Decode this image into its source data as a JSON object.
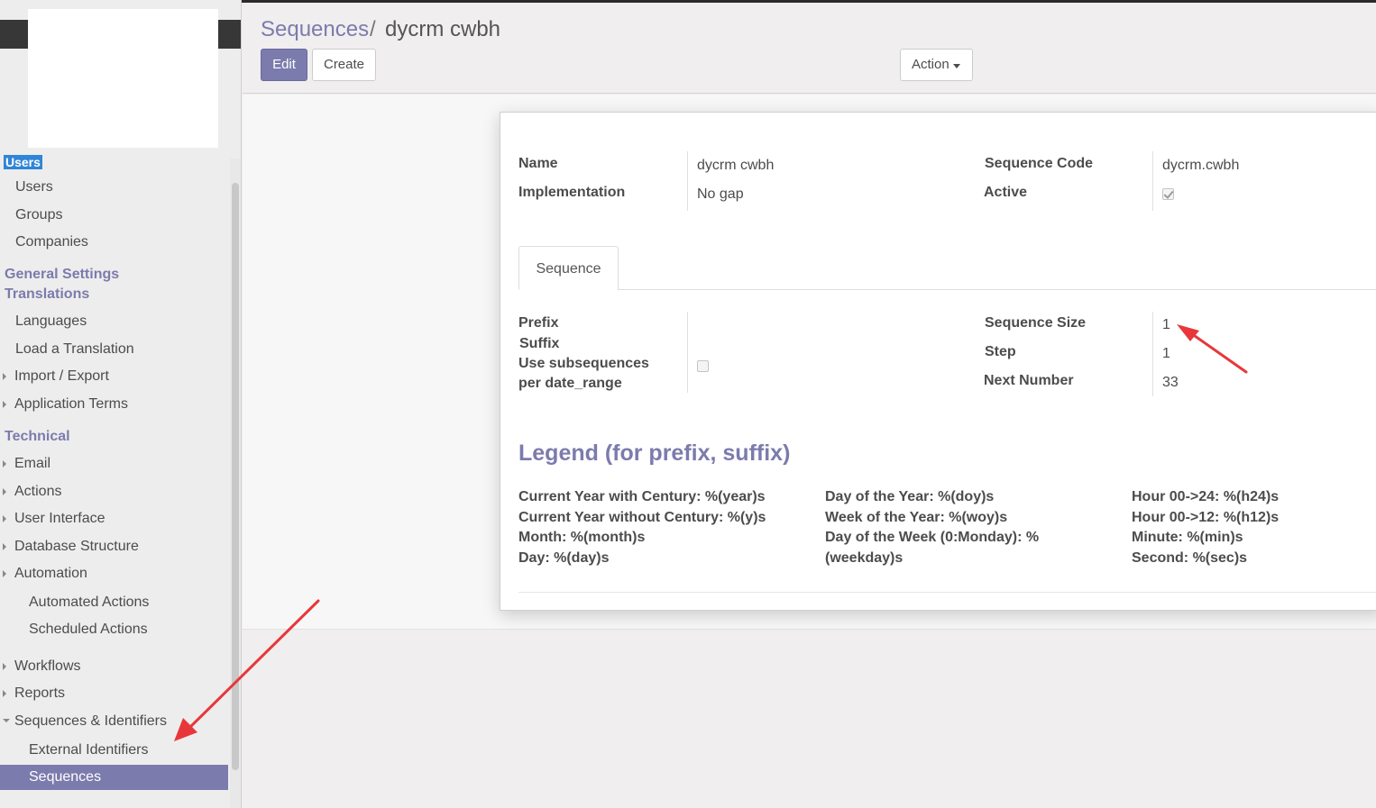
{
  "sidebar": {
    "section_users": "Users",
    "users_items": [
      "Users",
      "Groups",
      "Companies"
    ],
    "section_general": "General Settings",
    "section_translations": "Translations",
    "translation_items": [
      "Languages",
      "Load a Translation"
    ],
    "import_export": "Import / Export",
    "application_terms": "Application Terms",
    "section_technical": "Technical",
    "technical_items": [
      "Email",
      "Actions",
      "User Interface",
      "Database Structure",
      "Automation"
    ],
    "automation_children": [
      "Automated Actions",
      "Scheduled Actions"
    ],
    "workflows": "Workflows",
    "reports": "Reports",
    "sequences_identifiers": "Sequences & Identifiers",
    "seq_children": [
      "External Identifiers",
      "Sequences"
    ]
  },
  "control_panel": {
    "breadcrumb_parent": "Sequences",
    "breadcrumb_separator": "/",
    "breadcrumb_current": "dycrm cwbh",
    "edit_label": "Edit",
    "create_label": "Create",
    "action_label": "Action"
  },
  "form": {
    "name_label": "Name",
    "name_value": "dycrm cwbh",
    "implementation_label": "Implementation",
    "implementation_value": "No gap",
    "sequence_code_label": "Sequence Code",
    "sequence_code_value": "dycrm.cwbh",
    "active_label": "Active",
    "active_checked": true,
    "tab_label": "Sequence",
    "prefix_label": "Prefix",
    "suffix_label": "Suffix",
    "use_subseq_label_1": "Use subsequences",
    "use_subseq_label_2": "per date_range",
    "use_subseq_checked": false,
    "sequence_size_label": "Sequence Size",
    "sequence_size_value": "1",
    "step_label": "Step",
    "step_value": "1",
    "next_number_label": "Next Number",
    "next_number_value": "33"
  },
  "legend": {
    "title": "Legend (for prefix, suffix)",
    "col1": [
      "Current Year with Century: %(year)s",
      "Current Year without Century: %(y)s",
      "Month: %(month)s",
      "Day: %(day)s"
    ],
    "col2": [
      "Day of the Year: %(doy)s",
      "Week of the Year: %(woy)s",
      "Day of the Week (0:Monday): %",
      "(weekday)s"
    ],
    "col3": [
      "Hour 00->24: %(h24)s",
      "Hour 00->12: %(h12)s",
      "Minute: %(min)s",
      "Second: %(sec)s"
    ]
  },
  "colors": {
    "accent": "#7c7bad",
    "annotation_arrow": "#e8373a",
    "selected_header_bg": "#2f85d8"
  }
}
